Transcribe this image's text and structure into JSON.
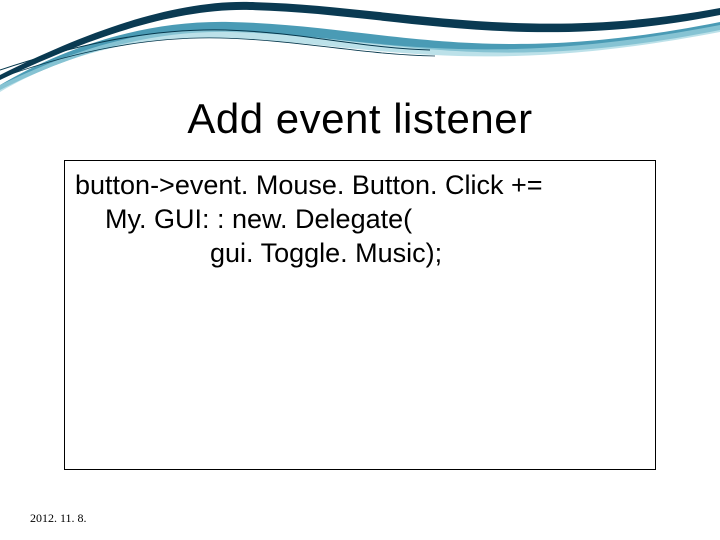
{
  "slide": {
    "title": "Add event listener",
    "code": {
      "line1": "button->event. Mouse. Button. Click +=",
      "line2": "    My. GUI: : new. Delegate(",
      "line3": "                  gui. Toggle. Music);"
    },
    "date": "2012. 11. 8."
  }
}
